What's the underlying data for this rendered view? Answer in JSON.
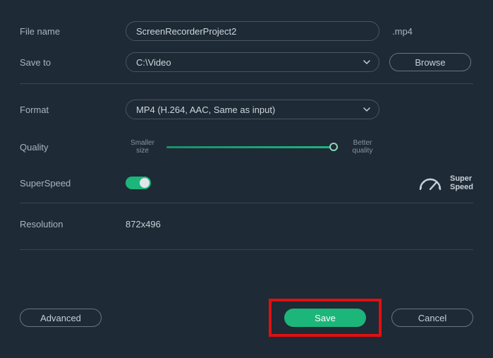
{
  "fields": {
    "file_name_label": "File name",
    "file_name_value": "ScreenRecorderProject2",
    "file_ext": ".mp4",
    "save_to_label": "Save to",
    "save_to_value": "C:\\Video",
    "browse_label": "Browse",
    "format_label": "Format",
    "format_value": "MP4 (H.264, AAC, Same as input)",
    "quality_label": "Quality",
    "quality_min": "Smaller size",
    "quality_max": "Better quality",
    "superspeed_label": "SuperSpeed",
    "superspeed_badge_l1": "Super",
    "superspeed_badge_l2": "Speed",
    "resolution_label": "Resolution",
    "resolution_value": "872x496"
  },
  "buttons": {
    "advanced": "Advanced",
    "save": "Save",
    "cancel": "Cancel"
  },
  "state": {
    "quality_position_pct": 97,
    "superspeed_on": true
  },
  "colors": {
    "accent": "#1cb57a",
    "highlight": "#e20f0f"
  }
}
